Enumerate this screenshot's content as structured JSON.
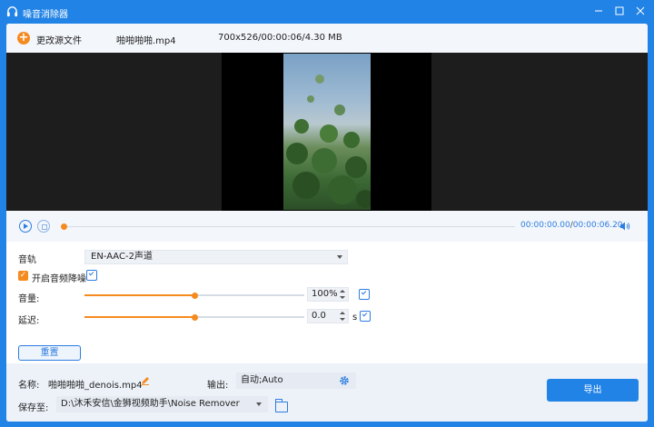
{
  "window": {
    "title": "噪音消除器"
  },
  "topbar": {
    "change_source_label": "更改源文件",
    "filename": "啪啪啪啪.mp4",
    "fileinfo": "700x526/00:00:06/4.30 MB"
  },
  "player": {
    "current_time": "00:00:00.00",
    "separator": "/",
    "total_time": "00:00:06.20",
    "progress": 0
  },
  "settings": {
    "track_label": "音轨",
    "track_value": "EN-AAC-2声道",
    "denoise_label": "开启音频降噪",
    "denoise_checked": true,
    "volume_label": "音量:",
    "volume_value": "100%",
    "volume_fraction": 0.5,
    "delay_label": "延迟:",
    "delay_value": "0.0",
    "delay_unit": "s",
    "delay_fraction": 0.5,
    "reset_label": "重置"
  },
  "output": {
    "name_label": "名称:",
    "name_value": "啪啪啪啪_denois.mp4",
    "output_label": "输出:",
    "output_value": "自动;Auto",
    "save_label": "保存至:",
    "save_path": "D:\\沐禾安信\\金狮视频助手\\Noise Remover",
    "export_label": "导出"
  },
  "colors": {
    "accent_blue": "#2283e6",
    "accent_orange": "#f58a1f"
  }
}
